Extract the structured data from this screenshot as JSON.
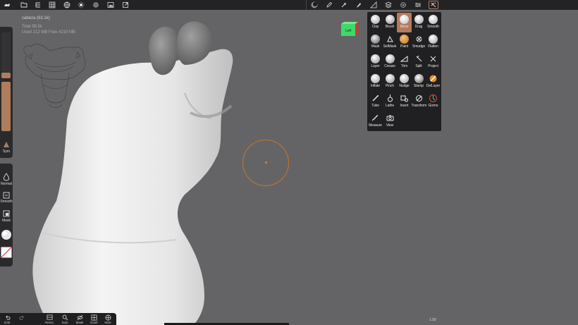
{
  "object_info": {
    "name": "cabeza (63.1k)",
    "total": "Total 98.5k",
    "memory": "Used 212 MB   Free 4210 MB"
  },
  "view_cube": {
    "label": "Left"
  },
  "tools": [
    {
      "label": "Clay",
      "icon": "clay-sphere-icon",
      "active": false
    },
    {
      "label": "Brush",
      "icon": "brush-sphere-icon",
      "active": false
    },
    {
      "label": "Move",
      "icon": "move-sphere-icon",
      "active": true
    },
    {
      "label": "Drag",
      "icon": "drag-sphere-icon",
      "active": false
    },
    {
      "label": "Smooth",
      "icon": "smooth-sphere-icon",
      "active": false
    },
    {
      "label": "Mask",
      "icon": "mask-sphere-icon",
      "active": false
    },
    {
      "label": "SelMask",
      "icon": "selmask-icon",
      "active": false
    },
    {
      "label": "Paint",
      "icon": "paint-sphere-icon",
      "active": false
    },
    {
      "label": "Smudge",
      "icon": "smudge-icon",
      "active": false
    },
    {
      "label": "Flatten",
      "icon": "flatten-sphere-icon",
      "active": false
    },
    {
      "label": "Layer",
      "icon": "layer-sphere-icon",
      "active": false
    },
    {
      "label": "Crease",
      "icon": "crease-sphere-icon",
      "active": false
    },
    {
      "label": "Trim",
      "icon": "trim-icon",
      "active": false
    },
    {
      "label": "Split",
      "icon": "split-icon",
      "active": false
    },
    {
      "label": "Project",
      "icon": "project-icon",
      "active": false
    },
    {
      "label": "Inflate",
      "icon": "inflate-sphere-icon",
      "active": false
    },
    {
      "label": "Pinch",
      "icon": "pinch-sphere-icon",
      "active": false
    },
    {
      "label": "Nudge",
      "icon": "nudge-sphere-icon",
      "active": false
    },
    {
      "label": "Stamp",
      "icon": "stamp-sphere-icon",
      "active": false
    },
    {
      "label": "DelLayer",
      "icon": "dellayer-icon",
      "active": false
    },
    {
      "label": "Tube",
      "icon": "tube-icon",
      "active": false
    },
    {
      "label": "Lathe",
      "icon": "lathe-icon",
      "active": false
    },
    {
      "label": "Insert",
      "icon": "insert-icon",
      "active": false
    },
    {
      "label": "Transform",
      "icon": "transform-icon",
      "active": false
    },
    {
      "label": "Gizmo",
      "icon": "gizmo-icon",
      "active": false
    },
    {
      "label": "Measure",
      "icon": "measure-icon",
      "active": false
    },
    {
      "label": "View",
      "icon": "camera-icon",
      "active": false
    }
  ],
  "left_panel": {
    "sym_label": "Sym",
    "normal_label": "Normal",
    "smooth_label": "Smooth",
    "mask_label": "Mask"
  },
  "bottom_bar": [
    {
      "label": "2/45",
      "icon": "undo-icon"
    },
    {
      "label": "",
      "icon": "redo-icon"
    },
    {
      "label": "Remo",
      "icon": "remesh-icon"
    },
    {
      "label": "Solo",
      "icon": "search-icon"
    },
    {
      "label": "Mask",
      "icon": "hide-icon"
    },
    {
      "label": "Voxel",
      "icon": "voxel-icon"
    },
    {
      "label": "Wire",
      "icon": "wire-icon"
    }
  ],
  "zoom": "1.58",
  "colors": {
    "accent": "#b57a5c",
    "brush_cursor": "#c5762a",
    "background": "#646466",
    "panel": "#202022"
  }
}
